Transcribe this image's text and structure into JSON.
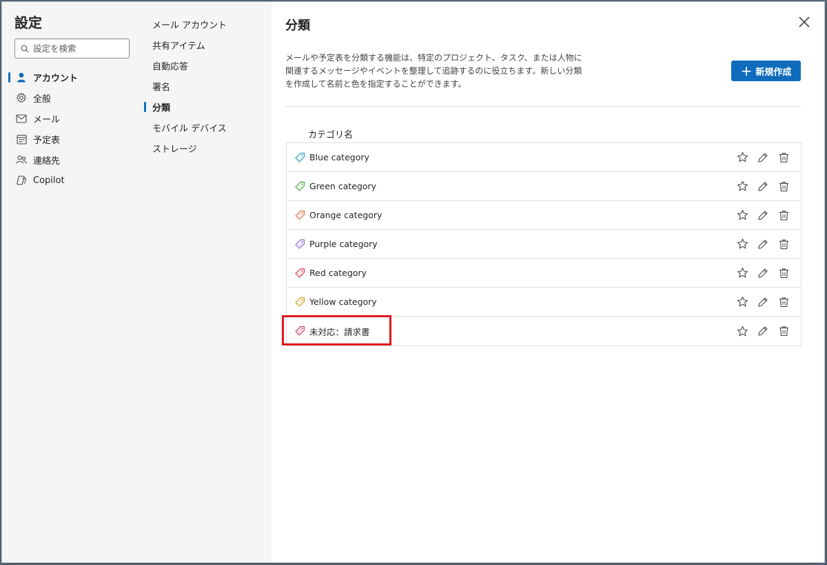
{
  "settings": {
    "title": "設定",
    "search_placeholder": "設定を検索"
  },
  "nav1": [
    {
      "label": "アカウント",
      "icon": "person-icon",
      "active": true
    },
    {
      "label": "全般",
      "icon": "gear-icon",
      "active": false
    },
    {
      "label": "メール",
      "icon": "mail-icon",
      "active": false
    },
    {
      "label": "予定表",
      "icon": "calendar-icon",
      "active": false
    },
    {
      "label": "連絡先",
      "icon": "people-icon",
      "active": false
    },
    {
      "label": "Copilot",
      "icon": "copilot-icon",
      "active": false
    }
  ],
  "nav2": [
    {
      "label": "メール アカウント",
      "active": false
    },
    {
      "label": "共有アイテム",
      "active": false
    },
    {
      "label": "自動応答",
      "active": false
    },
    {
      "label": "署名",
      "active": false
    },
    {
      "label": "分類",
      "active": true
    },
    {
      "label": "モバイル デバイス",
      "active": false
    },
    {
      "label": "ストレージ",
      "active": false
    }
  ],
  "main": {
    "title": "分類",
    "description": "メールや予定表を分類する機能は、特定のプロジェクト、タスク、または人物に関連するメッセージやイベントを整理して追跡するのに役立ちます。新しい分類を作成して名前と色を指定することができます。",
    "new_button": "新規作成",
    "column_header": "カテゴリ名",
    "categories": [
      {
        "name": "Blue category",
        "color": "#3aa0c4",
        "fill": "#e6f4fa"
      },
      {
        "name": "Green category",
        "color": "#4fa846",
        "fill": "#e8f5e6"
      },
      {
        "name": "Orange category",
        "color": "#e07a50",
        "fill": "#fbe9e1"
      },
      {
        "name": "Purple category",
        "color": "#8a73d6",
        "fill": "#eeeafa"
      },
      {
        "name": "Red category",
        "color": "#d6455a",
        "fill": "#fbe4e8"
      },
      {
        "name": "Yellow category",
        "color": "#c9a227",
        "fill": "#faf3dc"
      },
      {
        "name": "未対応：請求書",
        "color": "#c8526e",
        "fill": "#f8dce4"
      }
    ]
  },
  "colors": {
    "accent": "#0f6cbd",
    "highlight": "#e0171f"
  }
}
